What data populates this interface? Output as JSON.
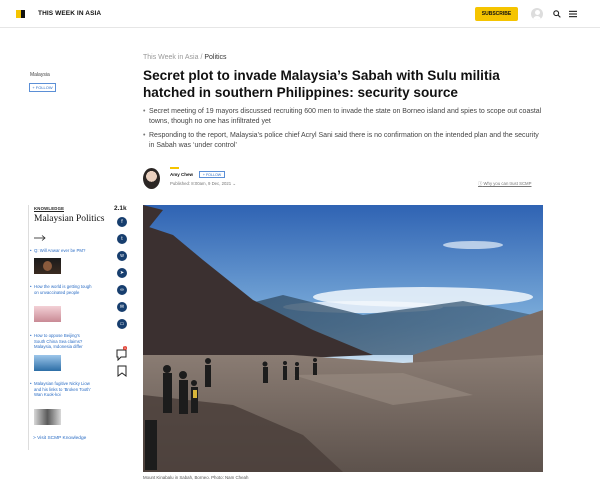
{
  "header": {
    "brand": "THIS WEEK IN ASIA",
    "subscribe_label": "SUBSCRIBE",
    "icons": [
      "logo-icon",
      "user-avatar-icon",
      "search-icon",
      "hamburger-menu-icon"
    ]
  },
  "meta": {
    "section_tag": "Malaysia",
    "follow_label": "+ FOLLOW"
  },
  "article": {
    "breadcrumb_root": "This Week in Asia",
    "breadcrumb_sep": "/",
    "breadcrumb_section": "Politics",
    "headline": "Secret plot to invade Malaysia’s Sabah with Sulu militia hatched in southern Philippines: security source",
    "bullets": [
      "Secret meeting of 19 mayors discussed recruiting 600 men to invade the state on Borneo island and spies to scope out coastal towns, though no one has infiltrated yet",
      "Responding to the report, Malaysia’s police chief Acryl Sani said there is no confirmation on the intended plan and the security in Sabah was ‘under control’"
    ],
    "author_name": "Amy Chew",
    "author_follow_label": "+ FOLLOW",
    "published": "Published: 8:00am, 9 Dec, 2021",
    "published_chevron": "⌄",
    "trust_link": "Why you can trust SCMP",
    "photo_caption": "Mount Kinabalu in Sabah, Borneo. Photo: Nam Cheah"
  },
  "knowledge": {
    "label": "KNOWLEDGE",
    "title": "Malaysian Politics",
    "items": [
      "Q: Will Anwar ever be PM?",
      "How the world is getting tough on unvaccinated people",
      "How to oppose Beijing's South China Sea claims? Malaysia, Indonesia differ",
      "Malaysian fugitive Nicky Liow and his links to ‘Broken Tooth’ Wan Kuok-koi"
    ],
    "visit_label": "> Visit SCMP Knowledge"
  },
  "share": {
    "count": "2.1k",
    "icons": [
      "facebook-icon",
      "twitter-icon",
      "whatsapp-icon",
      "telegram-icon",
      "copy-link-icon",
      "email-icon",
      "print-icon"
    ],
    "comment_badge": "1"
  },
  "colors": {
    "accent_yellow": "#f5c400",
    "link_blue": "#2a6cc4",
    "share_navy": "#173e6e"
  }
}
